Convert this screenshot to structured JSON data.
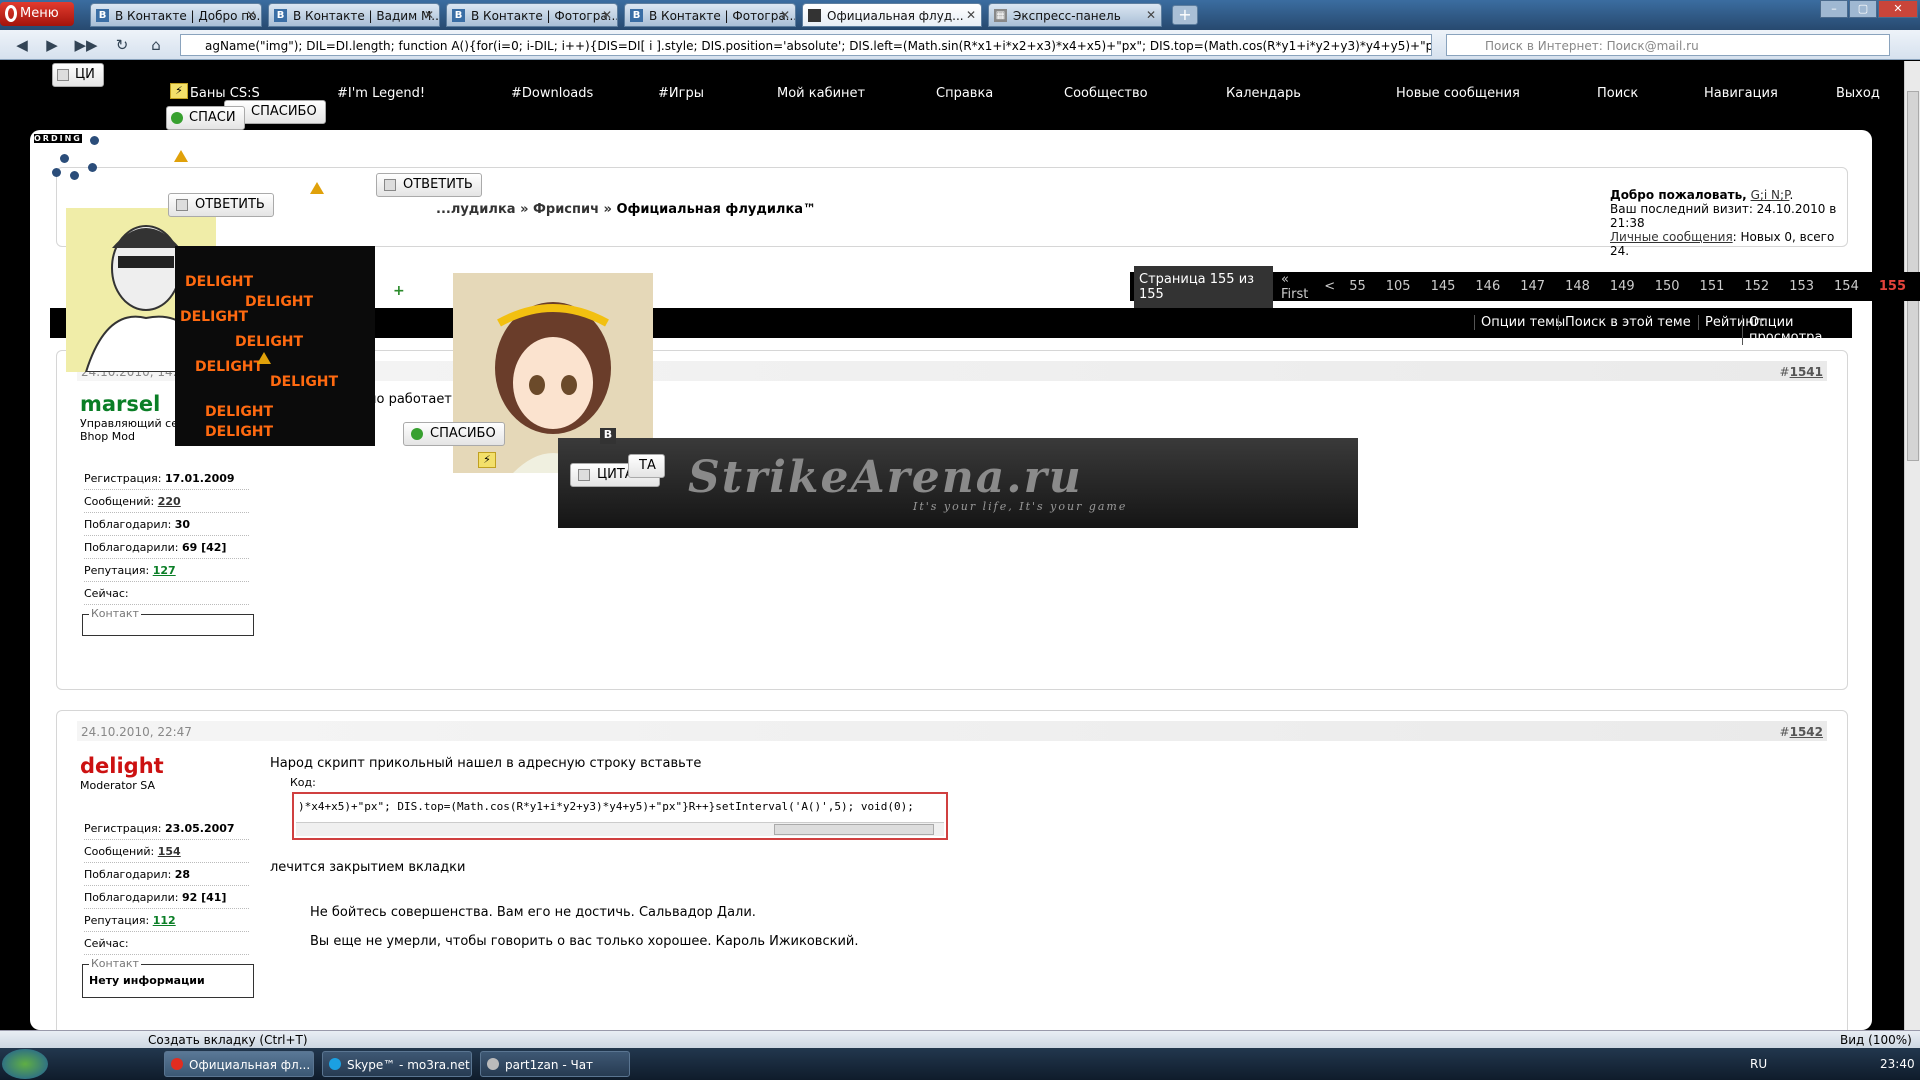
{
  "browser": {
    "menu_label": "Меню",
    "tabs": [
      {
        "label": "В Контакте | Добро по..."
      },
      {
        "label": "В Контакте | Вадим М..."
      },
      {
        "label": "В Контакте | Фотогра..."
      },
      {
        "label": "В Контакте | Фотогра..."
      },
      {
        "label": "Официальная флуд..."
      },
      {
        "label": "Экспресс-панель"
      }
    ],
    "address": "agName(\"img\"); DIL=DI.length; function A(){for(i=0; i-DIL; i++){DIS=DI[ i ].style; DIS.position='absolute'; DIS.left=(Math.sin(R*x1+i*x2+x3)*x4+x5)+\"px\"; DIS.top=(Math.cos(R*y1+i*y2+y3)*y4+y5)+\"px\"}R++}setInterval('A()',5); void(0)",
    "search_placeholder": "Поиск в Интернет: Поиск@mail.ru"
  },
  "forum": {
    "nav": [
      "Баны CS:S",
      "#I'm Legend!",
      "#Downloads",
      "#Игры",
      "Мой кабинет",
      "Справка",
      "Сообщество",
      "Календарь",
      "Новые сообщения",
      "Поиск",
      "Навигация",
      "Выход"
    ],
    "breadcrumb": [
      "...лудилка",
      "Фриспич",
      "Официальная флудилка™"
    ],
    "welcome": {
      "greeting": "Добро пожаловать,",
      "user": "G;i N;P",
      "last_visit": "Ваш последний визит: 24.10.2010 в 21:38",
      "pm_link": "Личные сообщения",
      "pm_text": ": Новых 0, всего 24."
    },
    "pager": {
      "label": "Страница 155 из 155",
      "first": "« First",
      "prev": "<",
      "pages": [
        "55",
        "105",
        "145",
        "146",
        "147",
        "148",
        "149",
        "150",
        "151",
        "152",
        "153",
        "154",
        "155"
      ],
      "current": "155"
    },
    "toolbar": [
      "Опции темы",
      "Поиск в этой теме",
      "Рейтинг:",
      "Опции просмотра"
    ],
    "posts": [
      {
        "date": "24.10.2010, 14:",
        "number": "1541",
        "author": "marsel",
        "author_color": "#0a7e26",
        "title1": "Управляющий сер",
        "title2": "Bhop Mod",
        "text": "но работает",
        "stats": {
          "reg_label": "Регистрация:",
          "reg": "17.01.2009",
          "msg_label": "Сообщений:",
          "msgs": "220",
          "thx_label": "Поблагодарил:",
          "thx": "30",
          "thxd_label": "Поблагодарили:",
          "thxd": "69 [42]",
          "rep_label": "Репутация:",
          "rep": "127",
          "now_label": "Сейчас:"
        },
        "contact_label": "Контакт",
        "contact_value": ""
      },
      {
        "date": "24.10.2010, 22:47",
        "number": "1542",
        "author": "delight",
        "author_color": "#cc1111",
        "title1": "Moderator SA",
        "text": "Народ скрипт прикольный нашел в адресную строку вставьте",
        "code_label": "Код:",
        "code": ")*x4+x5)+\"px\"; DIS.top=(Math.cos(R*y1+i*y2+y3)*y4+y5)+\"px\"}R++}setInterval('A()',5); void(0);",
        "after": "лечится закрытием вкладки",
        "sig1": "Не бойтесь совершенства. Вам его не достичь. Сальвадор Дали.",
        "sig2": "Вы еще не умерли, чтобы говорить о вас только хорошее. Кароль Ижиковский.",
        "stats": {
          "reg_label": "Регистрация:",
          "reg": "23.05.2007",
          "msg_label": "Сообщений:",
          "msgs": "154",
          "thx_label": "Поблагодарил:",
          "thx": "28",
          "thxd_label": "Поблагодарили:",
          "thxd": "92 [41]",
          "rep_label": "Репутация:",
          "rep": "112",
          "now_label": "Сейчас:"
        },
        "contact_label": "Контакт",
        "contact_value": "Нету информации"
      }
    ],
    "floating": {
      "reply1": "ОТВЕТИТЬ",
      "reply2": "ОТВЕТИТЬ",
      "thanks1": "СПАСИБО",
      "thanks2": "СПАСИ",
      "thanks3": "СПАСИБО",
      "quote1": "ЦИТАТА",
      "quote2": "ТА",
      "quote3": "ЦИ",
      "banner_title": "StrikeArena.ru",
      "banner_tagline": "It's your life, It's your game",
      "loading": "ORDING",
      "b_letter": "B"
    }
  },
  "statusbar": {
    "new_tab": "Создать вкладку (Ctrl+T)",
    "zoom": "Вид (100%)"
  },
  "taskbar": {
    "tasks": [
      "Официальная фл...",
      "Skype™ - mo3ra.net",
      "part1zan - Чат"
    ],
    "lang": "RU",
    "time": "23:40"
  }
}
